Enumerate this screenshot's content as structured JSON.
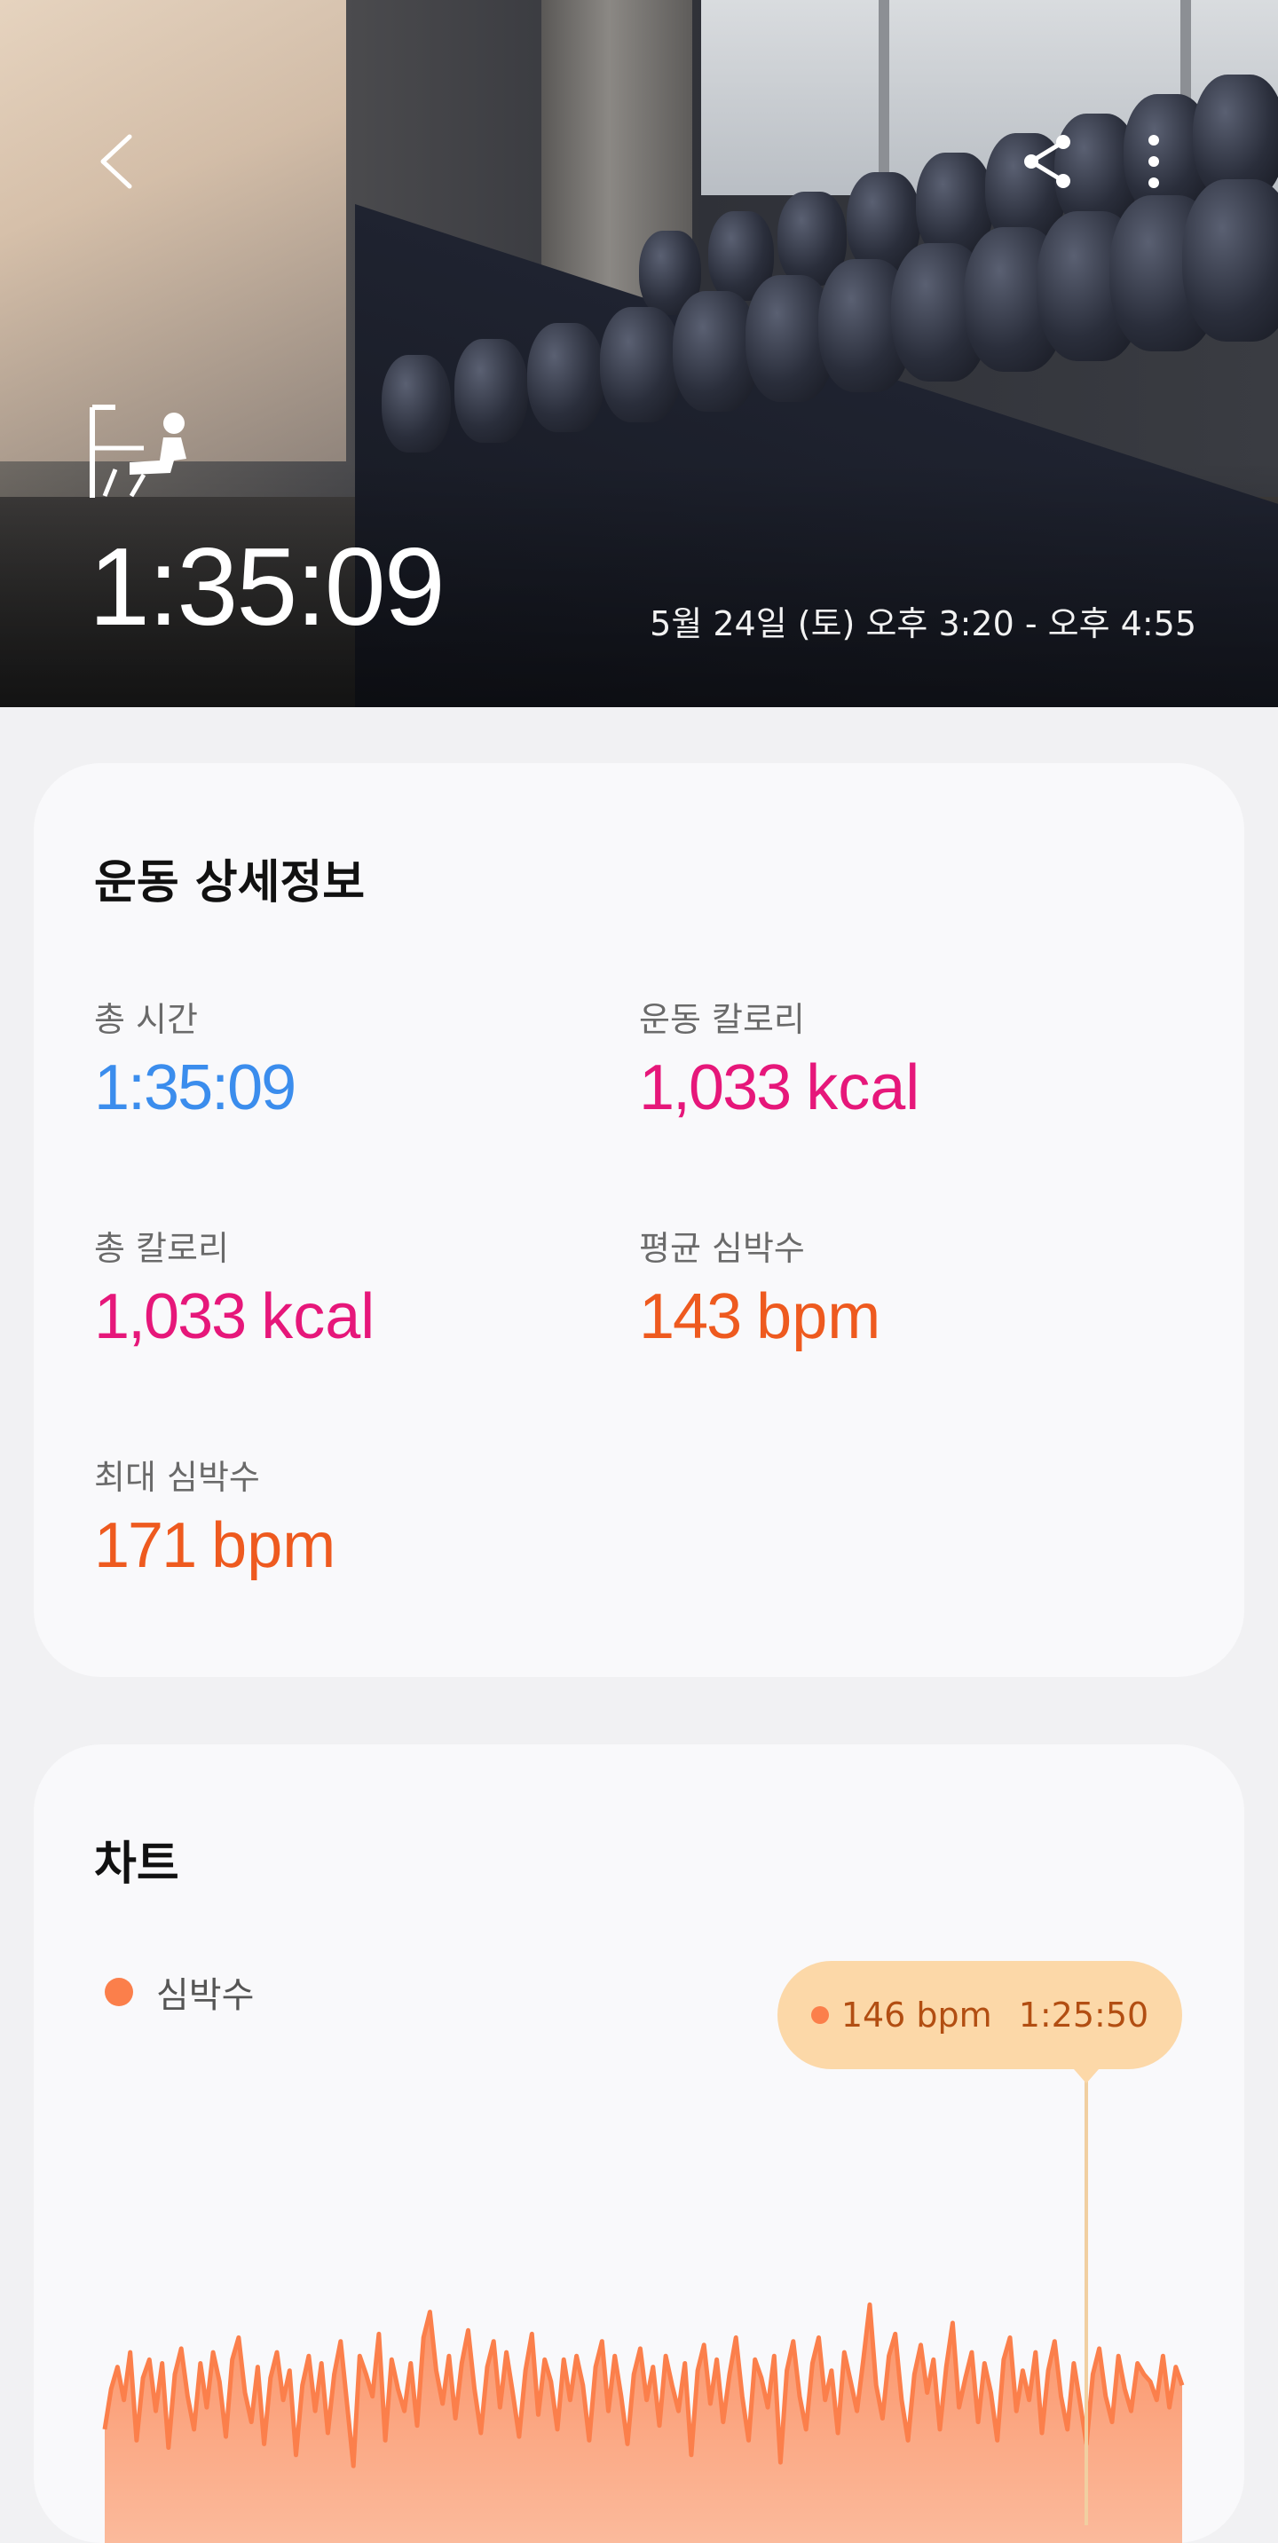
{
  "hero": {
    "duration": "1:35:09",
    "date_range": "5월 24일 (토) 오후 3:20 - 오후 4:55",
    "icons": {
      "back": "chevron-left-icon",
      "share": "share-icon",
      "more": "more-vert-icon",
      "workout": "weight-machine-icon"
    }
  },
  "details": {
    "title": "운동 상세정보",
    "stats": [
      {
        "label": "총 시간",
        "value": "1:35:09",
        "unit": "",
        "color": "#3b8ded"
      },
      {
        "label": "운동 칼로리",
        "value": "1,033",
        "unit": "kcal",
        "color": "#e6177a"
      },
      {
        "label": "총 칼로리",
        "value": "1,033",
        "unit": "kcal",
        "color": "#e6177a"
      },
      {
        "label": "평균 심박수",
        "value": "143",
        "unit": "bpm",
        "color": "#ee5a1f"
      },
      {
        "label": "최대 심박수",
        "value": "171",
        "unit": "bpm",
        "color": "#ee5a1f"
      }
    ]
  },
  "chart": {
    "title": "차트",
    "legend": "심박수",
    "tooltip_value": "146 bpm",
    "tooltip_time": "1:25:50",
    "colors": {
      "series": "#fb7f4b",
      "tooltip_bg": "#fcd8a8"
    }
  },
  "chart_data": {
    "type": "area",
    "series": [
      {
        "name": "심박수",
        "values": [
          131,
          142,
          148,
          139,
          152,
          128,
          145,
          150,
          136,
          149,
          126,
          146,
          153,
          140,
          131,
          149,
          137,
          152,
          144,
          129,
          150,
          156,
          141,
          133,
          148,
          127,
          145,
          152,
          139,
          147,
          124,
          143,
          151,
          136,
          149,
          130,
          146,
          155,
          138,
          121,
          151,
          146,
          140,
          157,
          128,
          150,
          142,
          136,
          149,
          132,
          156,
          163,
          147,
          138,
          151,
          134,
          149,
          158,
          142,
          130,
          148,
          155,
          137,
          152,
          141,
          129,
          147,
          157,
          135,
          150,
          144,
          131,
          150,
          139,
          151,
          143,
          128,
          148,
          155,
          136,
          151,
          140,
          127,
          146,
          153,
          139,
          148,
          132,
          151,
          143,
          136,
          149,
          124,
          147,
          154,
          138,
          150,
          133,
          146,
          156,
          140,
          128,
          150,
          145,
          137,
          151,
          122,
          147,
          155,
          140,
          131,
          149,
          156,
          139,
          147,
          130,
          152,
          144,
          136,
          150,
          165,
          143,
          134,
          151,
          157,
          139,
          128,
          146,
          154,
          141,
          150,
          131,
          148,
          160,
          137,
          145,
          152,
          133,
          149,
          141,
          128,
          150,
          156,
          136,
          147,
          139,
          152,
          130,
          147,
          155,
          140,
          131,
          149,
          138,
          127,
          146,
          153,
          140,
          133,
          151,
          142,
          136,
          149,
          146,
          144,
          139,
          151,
          137,
          148,
          143
        ]
      }
    ]
  }
}
